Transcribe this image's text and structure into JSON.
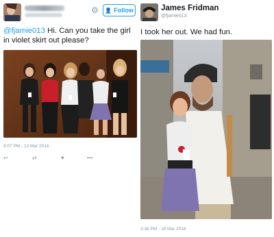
{
  "left_tweet": {
    "follow_label": "Follow",
    "text_mention": "@fjamie013",
    "text_body": " Hi. Can you take the girl in violet skirt out please?",
    "timestamp": "9:07 PM - 13 Mar 2016",
    "icons": [
      "reply-icon",
      "retweet-icon",
      "like-icon",
      "more-icon"
    ]
  },
  "right_tweet": {
    "display_name": "James Fridman",
    "screen_name": "@fjamie013",
    "text": "I took her out. We had fun.",
    "timestamp": "3:36 PM - 16 Mar 2016"
  },
  "colors": {
    "twitter_blue": "#1da1f2",
    "meta_gray": "#8899a6",
    "text_dark": "#14171a",
    "skirt_violet": "#7f74b0"
  }
}
